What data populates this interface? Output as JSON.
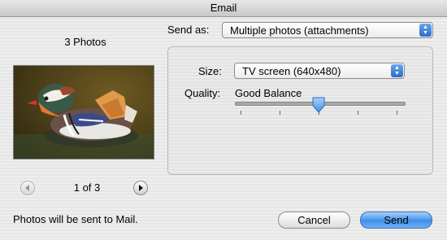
{
  "window": {
    "title": "Email"
  },
  "preview": {
    "count_label": "3 Photos",
    "photo_alt": "Mandarin duck photo",
    "counter": "1 of 3"
  },
  "send_as": {
    "label": "Send as:",
    "value": "Multiple photos (attachments)"
  },
  "size": {
    "label": "Size:",
    "value": "TV screen (640x480)"
  },
  "quality": {
    "label": "Quality:",
    "value": "Good Balance",
    "level_fraction": 0.5,
    "tick_count": 5
  },
  "footer": {
    "message": "Photos will be sent to Mail."
  },
  "buttons": {
    "cancel": "Cancel",
    "send": "Send"
  },
  "icons": {
    "prev": "left-arrow-icon",
    "next": "right-arrow-icon",
    "popup": "up-down-arrows-icon",
    "slider": "slider-thumb-icon"
  },
  "colors": {
    "accent": "#3f8fe8",
    "slider_thumb": "#5a9ce6"
  }
}
